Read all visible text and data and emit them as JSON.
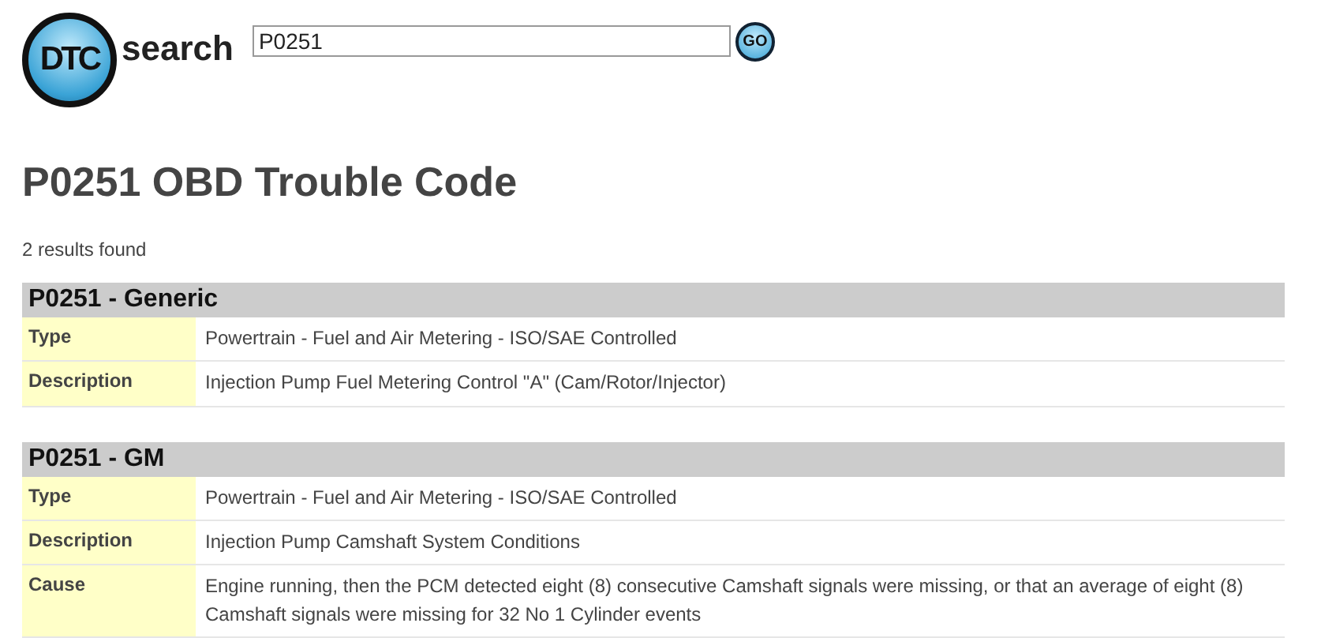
{
  "header": {
    "logo_text": "DTC",
    "brand": "search",
    "search": {
      "value": "P0251"
    },
    "go_button": "GO"
  },
  "title": "P0251 OBD Trouble Code",
  "result_count": "2 results found",
  "results": [
    {
      "heading": "P0251 - Generic",
      "rows": [
        {
          "label": "Type",
          "value": "Powertrain - Fuel and Air Metering - ISO/SAE Controlled"
        },
        {
          "label": "Description",
          "value": "Injection Pump Fuel Metering Control \"A\" (Cam/Rotor/Injector)"
        }
      ]
    },
    {
      "heading": "P0251 - GM",
      "rows": [
        {
          "label": "Type",
          "value": "Powertrain - Fuel and Air Metering - ISO/SAE Controlled"
        },
        {
          "label": "Description",
          "value": "Injection Pump Camshaft System Conditions"
        },
        {
          "label": "Cause",
          "value": "Engine running, then the PCM detected eight (8) consecutive Camshaft signals were missing, or that an average of eight (8) Camshaft signals were missing for 32 No 1 Cylinder events"
        }
      ]
    }
  ]
}
